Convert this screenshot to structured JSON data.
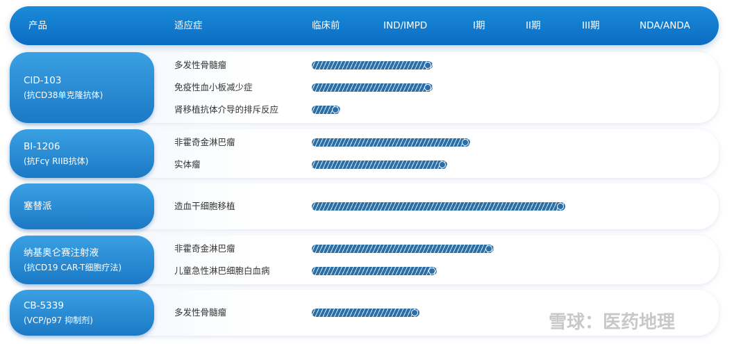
{
  "header": {
    "columns": [
      "产品",
      "适应症",
      "临床前",
      "IND/IMPD",
      "I期",
      "II期",
      "III期",
      "NDA/ANDA"
    ]
  },
  "colors": {
    "header": "#0b6cc2",
    "pill": "#2a8ad6",
    "bar": "#2b6fa8"
  },
  "chart_data": {
    "type": "bar",
    "orientation": "horizontal",
    "stages": [
      "临床前",
      "IND/IMPD",
      "I期",
      "II期",
      "III期",
      "NDA/ANDA"
    ],
    "value_unit": "stage index (0 = start of 临床前, 6 = end of NDA/ANDA)",
    "xlim": [
      0,
      6
    ],
    "products": [
      {
        "name": "CID-103",
        "subtitle": "(抗CD38单克隆抗体)",
        "indications": [
          {
            "label": "多发性骨髓瘤",
            "progress": 1.55
          },
          {
            "label": "免疫性血小板减少症",
            "progress": 1.55
          },
          {
            "label": "肾移植抗体介导的排斥反应",
            "progress": 0.4
          }
        ]
      },
      {
        "name": "BI-1206",
        "subtitle": "(抗Fcγ RIIB抗体)",
        "indications": [
          {
            "label": "非霍奇金淋巴瘤",
            "progress": 1.97
          },
          {
            "label": "实体瘤",
            "progress": 1.71
          }
        ]
      },
      {
        "name": "塞替派",
        "subtitle": "",
        "indications": [
          {
            "label": "造血干细胞移植",
            "progress": 3.7
          }
        ]
      },
      {
        "name": "纳基奥仑赛注射液",
        "subtitle": "(抗CD19 CAR-T细胞疗法)",
        "indications": [
          {
            "label": "非霍奇金淋巴瘤",
            "progress": 2.4
          },
          {
            "label": "儿童急性淋巴细胞白血病",
            "progress": 1.6
          }
        ]
      },
      {
        "name": "CB-5339",
        "subtitle": "(VCP/p97 抑制剂)",
        "indications": [
          {
            "label": "多发性骨髓瘤",
            "progress": 1.4
          }
        ]
      }
    ]
  },
  "watermark": "雪球：医药地理"
}
